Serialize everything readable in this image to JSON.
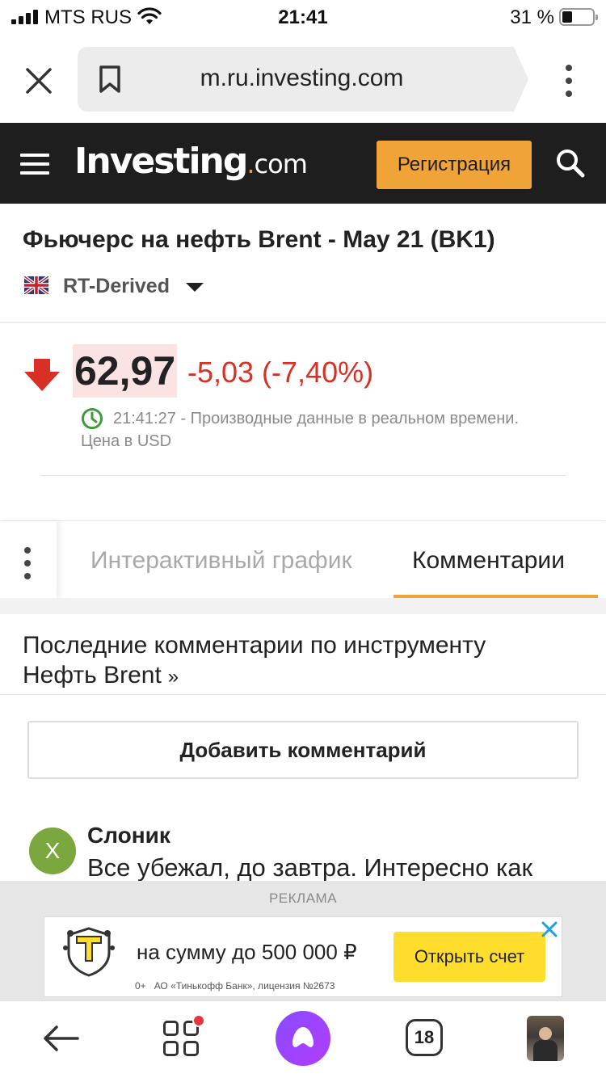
{
  "status_bar": {
    "carrier": "MTS RUS",
    "time": "21:41",
    "battery": "31 %"
  },
  "browser": {
    "url": "m.ru.investing.com"
  },
  "site_header": {
    "logo_main": "Investing",
    "logo_suffix": ".com",
    "register_label": "Регистрация"
  },
  "instrument": {
    "title": "Фьючерс на нефть Brent - May 21 (BK1)",
    "exchange": "RT-Derived",
    "price": "62,97",
    "change": "-5,03 (-7,40%)",
    "time_note": "21:41:27 - Производные данные в реальном времени.",
    "currency_note": "Цена в USD",
    "colors": {
      "negative": "#d93025",
      "price_highlight": "#fbe3e3"
    }
  },
  "tabs": [
    {
      "label": "Интерактивный график",
      "active": false
    },
    {
      "label": "Комментарии",
      "active": true
    }
  ],
  "comments": {
    "heading": "Последние комментарии по инструменту Нефть Brent",
    "heading_arrow": "»",
    "add_button": "Добавить комментарий",
    "items": [
      {
        "avatar_letter": "X",
        "author": "Слоник",
        "text": "Все убежал, до завтра. Интересно как"
      }
    ]
  },
  "ad": {
    "label": "РЕКЛАМА",
    "main_text": "на сумму до 500 000 ₽",
    "age": "0+",
    "legal": "АО «Тинькофф Банк», лицензия №2673",
    "cta": "Открыть счет"
  },
  "bottom_nav": {
    "tab_count": "18",
    "icons": [
      "back-arrow-icon",
      "services-grid-icon",
      "alice-assistant-icon",
      "tabs-icon",
      "profile-avatar"
    ]
  },
  "accent_color": "#f0a336"
}
